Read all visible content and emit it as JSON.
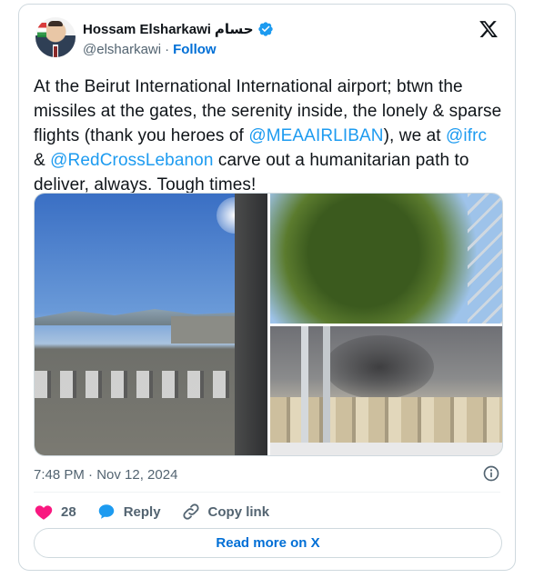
{
  "author": {
    "name": "Hossam Elsharkawi",
    "name_arabic": "حسام",
    "handle": "@elsharkawi",
    "separator": "·",
    "follow_label": "Follow"
  },
  "tweet": {
    "parts": [
      {
        "text": "At the Beirut International International airport; btwn the missiles at the gates, the serenity inside, the lonely & sparse flights (thank you heroes of ",
        "type": "text"
      },
      {
        "text": "@MEAAIRLIBAN",
        "type": "mention"
      },
      {
        "text": "), we at ",
        "type": "text"
      },
      {
        "text": "@ifrc",
        "type": "mention"
      },
      {
        "text": " & ",
        "type": "text"
      },
      {
        "text": "@RedCrossLebanon",
        "type": "mention"
      },
      {
        "text": " carve out a humanitarian path to deliver, always. Tough times!",
        "type": "text"
      }
    ],
    "timestamp": "7:48 PM · Nov 12, 2024"
  },
  "actions": {
    "likes": "28",
    "reply_label": "Reply",
    "copy_label": "Copy link"
  },
  "read_more_label": "Read more on X",
  "colors": {
    "link": "#1d9bf0",
    "like": "#f91880",
    "verified": "#1d9bf0"
  },
  "icons": [
    "verified-badge-icon",
    "x-logo-icon",
    "info-icon",
    "heart-icon",
    "reply-icon",
    "link-icon"
  ]
}
